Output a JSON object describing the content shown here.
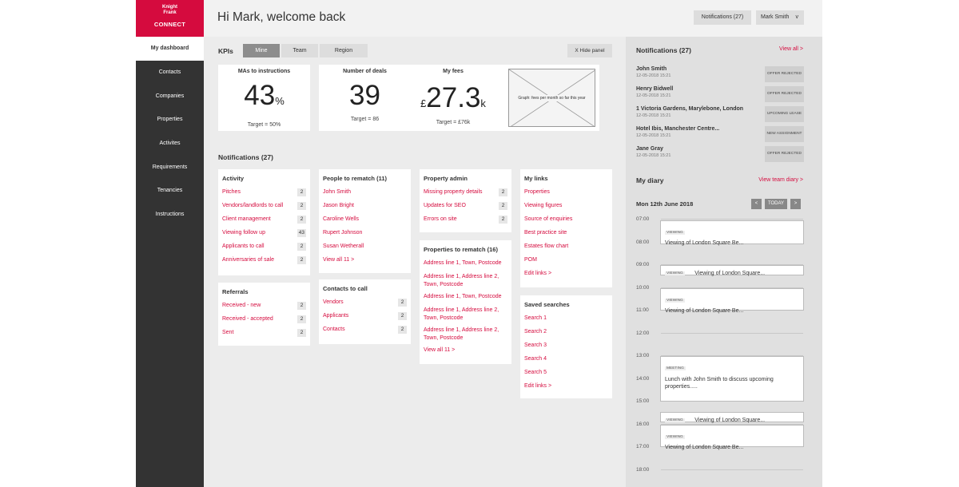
{
  "brand": {
    "line1": "Knight",
    "line2": "Frank",
    "product": "CONNECT",
    "accent": "#d50b3e"
  },
  "sidebar": {
    "active": "My dashboard",
    "items": [
      "Contacts",
      "Companies",
      "Properties",
      "Activites",
      "Requirements",
      "Tenancies",
      "Instructions"
    ]
  },
  "header": {
    "greeting": "Hi Mark, welcome back",
    "notifications": "Notifications (27)",
    "user": "Mark Smith",
    "user_chevron": "v"
  },
  "kpis": {
    "title": "KPIs",
    "tabs": [
      "Mine",
      "Team",
      "Region"
    ],
    "hide_panel": "X   Hide panel",
    "cards": [
      {
        "label": "MAs to instructions",
        "value": "43",
        "unit": "%",
        "target": "Target = 50%"
      },
      {
        "label": "Number of deals",
        "value": "39",
        "unit": "",
        "target": "Target = 86"
      }
    ],
    "fees": {
      "label": "My fees",
      "prefix": "£",
      "value": "27.3",
      "unit": "k",
      "target": "Target = £76k"
    },
    "graph_label": "Graph: fees per month so far this year"
  },
  "main": {
    "title": "Notifications (27)",
    "activity": {
      "title": "Activity",
      "rows": [
        {
          "label": "Pitches",
          "count": "2"
        },
        {
          "label": "Vendors/landlords to call",
          "count": "2"
        },
        {
          "label": "Client management",
          "count": "2"
        },
        {
          "label": "Viewing follow up",
          "count": "43"
        },
        {
          "label": "Applicants to call",
          "count": "2"
        },
        {
          "label": "Anniversaries of sale",
          "count": "2"
        }
      ]
    },
    "referrals": {
      "title": "Referrals",
      "rows": [
        {
          "label": "Received - new",
          "count": "2"
        },
        {
          "label": "Received - accepted",
          "count": "2"
        },
        {
          "label": "Sent",
          "count": "2"
        }
      ]
    },
    "rematch": {
      "title": "People to rematch (11)",
      "rows": [
        "John Smith",
        "Jason Bright",
        "Caroline Wells",
        "Rupert Johnson",
        "Susan Wetherall"
      ],
      "view_all": "View all 11   >"
    },
    "contacts_to_call": {
      "title": "Contacts to call",
      "rows": [
        {
          "label": "Vendors",
          "count": "2"
        },
        {
          "label": "Applicants",
          "count": "2"
        },
        {
          "label": "Contacts",
          "count": "2"
        }
      ]
    },
    "property_admin": {
      "title": "Property admin",
      "rows": [
        {
          "label": "Missing property details",
          "count": "2"
        },
        {
          "label": "Updates for SEO",
          "count": "2"
        },
        {
          "label": "Errors on site",
          "count": "2"
        }
      ]
    },
    "properties_rematch": {
      "title": "Properties to rematch (16)",
      "rows": [
        "Address line 1, Town, Postcode",
        "Address line 1, Address line 2, Town, Postcode",
        "Address line 1, Town, Postcode",
        "Address line 1, Address line 2, Town, Postcode",
        "Address line 1, Address line 2, Town, Postcode"
      ],
      "view_all": "View all 11   >"
    },
    "my_links": {
      "title": "My links",
      "rows": [
        "Properties",
        "Viewing figures",
        "Source of enquiries",
        "Best practice site",
        "Estates flow chart",
        "POM"
      ],
      "edit": "Edit links   >"
    },
    "saved_searches": {
      "title": "Saved searches",
      "rows": [
        "Search 1",
        "Search 2",
        "Search 3",
        "Search 4",
        "Search 5"
      ],
      "edit": "Edit links   >"
    }
  },
  "right": {
    "notif_title": "Notifications (27)",
    "notif_link": "View all   >",
    "notifications": [
      {
        "name": "John Smith",
        "time": "12-05-2018  15:21",
        "tag": "OFFER REJECTED"
      },
      {
        "name": "Henry Bidwell",
        "time": "12-05-2018  15:21",
        "tag": "OFFER REJECTED"
      },
      {
        "name": "1 Victoria Gardens, Marylebone, London",
        "time": "12-05-2018  15:21",
        "tag": "UPCOMING LEASE"
      },
      {
        "name": "Hotel Ibis, Manchester Centre...",
        "time": "12-05-2018  15:21",
        "tag": "NEW ASSIGNMENT"
      },
      {
        "name": "Jane Gray",
        "time": "12-05-2018  15:21",
        "tag": "OFFER REJECTED"
      }
    ],
    "diary_title": "My diary",
    "diary_link": "View team diary   >",
    "date": "Mon 12th June 2018",
    "prev": "<",
    "today": "TODAY",
    "next": ">",
    "hours": [
      "07:00",
      "08:00",
      "09:00",
      "10:00",
      "11:00",
      "12:00",
      "13:00",
      "14:00",
      "15:00",
      "16:00",
      "17:00",
      "18:00"
    ],
    "events": [
      {
        "type": "VIEWING",
        "text": "Viewing of London Square Be..."
      },
      {
        "type": "VIEWING",
        "text": "Viewing of London Square..."
      },
      {
        "type": "VIEWING",
        "text": "Viewing of London Square Be..."
      },
      {
        "type": "MEETING",
        "text": "Lunch with John Smith to discuss upcoming properties....."
      },
      {
        "type": "VIEWING",
        "text": "Viewing of London Square..."
      },
      {
        "type": "VIEWING",
        "text": "Viewing of London Square Be..."
      }
    ]
  }
}
